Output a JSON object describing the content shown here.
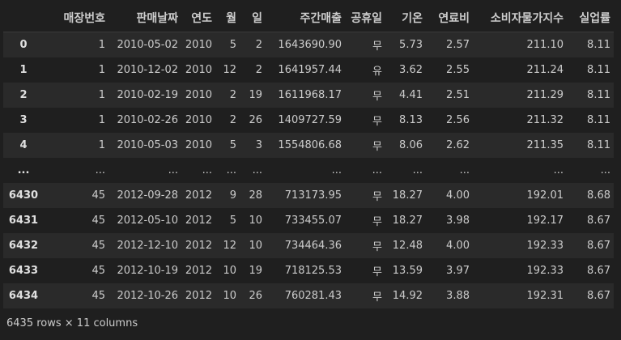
{
  "table": {
    "columns": [
      "",
      "매장번호",
      "판매날짜",
      "연도",
      "월",
      "일",
      "주간매출",
      "공휴일",
      "기온",
      "연료비",
      "소비자물가지수",
      "실업률"
    ],
    "rows": [
      [
        "0",
        "1",
        "2010-05-02",
        "2010",
        "5",
        "2",
        "1643690.90",
        "무",
        "5.73",
        "2.57",
        "211.10",
        "8.11"
      ],
      [
        "1",
        "1",
        "2010-12-02",
        "2010",
        "12",
        "2",
        "1641957.44",
        "유",
        "3.62",
        "2.55",
        "211.24",
        "8.11"
      ],
      [
        "2",
        "1",
        "2010-02-19",
        "2010",
        "2",
        "19",
        "1611968.17",
        "무",
        "4.41",
        "2.51",
        "211.29",
        "8.11"
      ],
      [
        "3",
        "1",
        "2010-02-26",
        "2010",
        "2",
        "26",
        "1409727.59",
        "무",
        "8.13",
        "2.56",
        "211.32",
        "8.11"
      ],
      [
        "4",
        "1",
        "2010-05-03",
        "2010",
        "5",
        "3",
        "1554806.68",
        "무",
        "8.06",
        "2.62",
        "211.35",
        "8.11"
      ],
      [
        "...",
        "...",
        "...",
        "...",
        "...",
        "...",
        "...",
        "...",
        "...",
        "...",
        "...",
        "..."
      ],
      [
        "6430",
        "45",
        "2012-09-28",
        "2012",
        "9",
        "28",
        "713173.95",
        "무",
        "18.27",
        "4.00",
        "192.01",
        "8.68"
      ],
      [
        "6431",
        "45",
        "2012-05-10",
        "2012",
        "5",
        "10",
        "733455.07",
        "무",
        "18.27",
        "3.98",
        "192.17",
        "8.67"
      ],
      [
        "6432",
        "45",
        "2012-12-10",
        "2012",
        "12",
        "10",
        "734464.36",
        "무",
        "12.48",
        "4.00",
        "192.33",
        "8.67"
      ],
      [
        "6433",
        "45",
        "2012-10-19",
        "2012",
        "10",
        "19",
        "718125.53",
        "무",
        "13.59",
        "3.97",
        "192.33",
        "8.67"
      ],
      [
        "6434",
        "45",
        "2012-10-26",
        "2012",
        "10",
        "26",
        "760281.43",
        "무",
        "14.92",
        "3.88",
        "192.31",
        "8.67"
      ]
    ]
  },
  "footer": {
    "summary": "6435 rows × 11 columns"
  }
}
